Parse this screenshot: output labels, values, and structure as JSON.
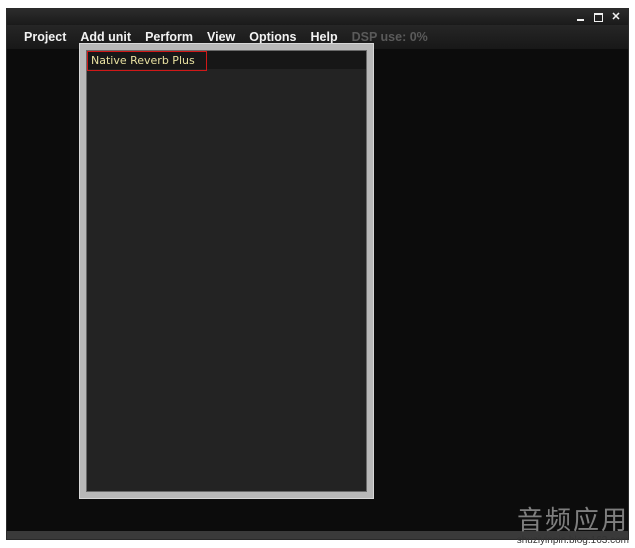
{
  "window": {
    "controls": {
      "minimize": "_",
      "maximize": "□",
      "close": "✕"
    }
  },
  "menubar": {
    "items": [
      "Project",
      "Add unit",
      "Perform",
      "View",
      "Options",
      "Help"
    ],
    "dsp_status": "DSP use: 0%"
  },
  "panel": {
    "selected_unit": "Native Reverb Plus"
  },
  "watermark": {
    "text": "音频应用",
    "url": "shuziyinpin.blog.163.com"
  },
  "colors": {
    "background": "#0c0c0c",
    "menu_text": "#f2f2f2",
    "dsp_text": "#5a5a5a",
    "unit_text": "#e8e0a0",
    "selection_border": "#d01818"
  }
}
